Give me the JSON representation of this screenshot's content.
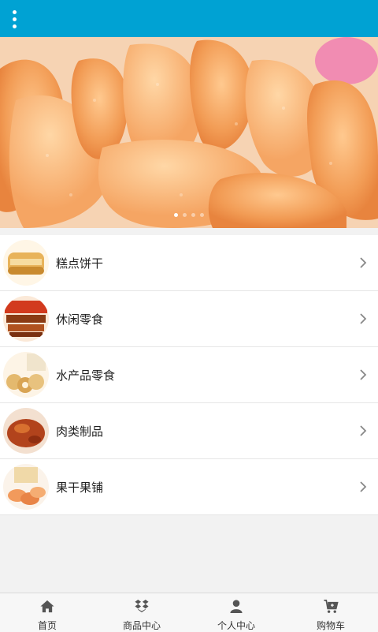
{
  "header": {
    "menu_icon": "more-vertical-icon",
    "bar_color": "#00a2d3"
  },
  "banner": {
    "slide_count": 4,
    "active_slide": 1
  },
  "categories": [
    {
      "label": "糕点饼干",
      "icon": "pastry-thumbnail"
    },
    {
      "label": "休闲零食",
      "icon": "snack-thumbnail"
    },
    {
      "label": "水产品零食",
      "icon": "seafood-thumbnail"
    },
    {
      "label": "肉类制品",
      "icon": "meat-thumbnail"
    },
    {
      "label": "果干果铺",
      "icon": "dried-fruit-thumbnail"
    }
  ],
  "bottom_nav": [
    {
      "label": "首页",
      "icon": "home-icon"
    },
    {
      "label": "商品中心",
      "icon": "dropbox-icon"
    },
    {
      "label": "个人中心",
      "icon": "user-icon"
    },
    {
      "label": "购物车",
      "icon": "cart-icon"
    }
  ]
}
